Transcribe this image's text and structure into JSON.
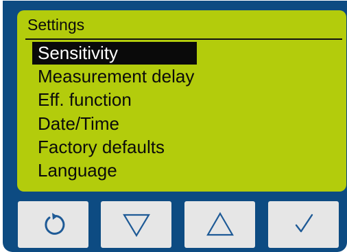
{
  "screen": {
    "title": "Settings",
    "items": [
      {
        "label": "Sensitivity",
        "selected": true
      },
      {
        "label": "Measurement delay",
        "selected": false
      },
      {
        "label": "Eff. function",
        "selected": false
      },
      {
        "label": "Date/Time",
        "selected": false
      },
      {
        "label": "Factory defaults",
        "selected": false
      },
      {
        "label": "Language",
        "selected": false
      }
    ]
  },
  "buttons": [
    {
      "name": "back-button",
      "icon": "rotate-back-icon"
    },
    {
      "name": "down-button",
      "icon": "triangle-down-icon"
    },
    {
      "name": "up-button",
      "icon": "triangle-up-icon"
    },
    {
      "name": "confirm-button",
      "icon": "check-icon"
    }
  ],
  "colors": {
    "housing": "#0d4b82",
    "lcd_background": "#b3cc0c",
    "text": "#0b0b0b",
    "highlight_background": "#0a0a0a",
    "highlight_text": "#ffffff",
    "button_face": "#e6e6e6",
    "icon": "#1e5a96"
  }
}
